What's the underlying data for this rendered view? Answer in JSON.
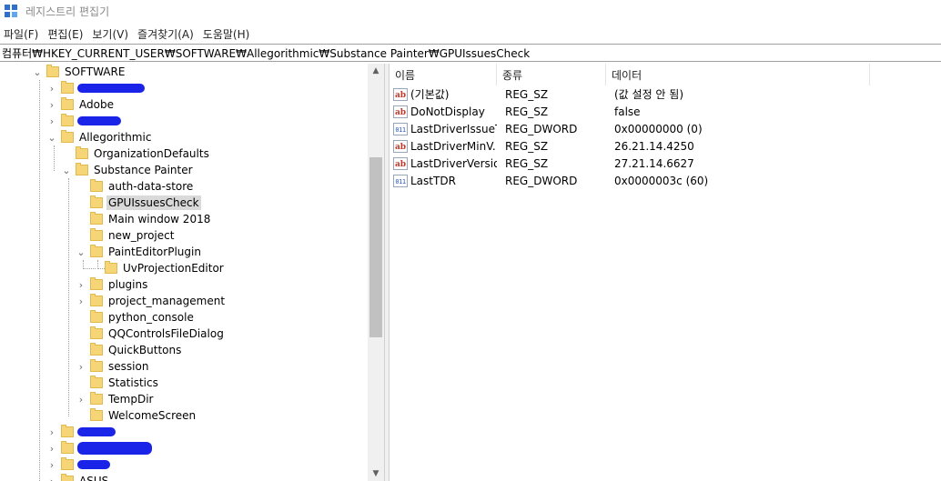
{
  "window": {
    "title": "레지스트리 편집기"
  },
  "menu": [
    "파일(F)",
    "편집(E)",
    "보기(V)",
    "즐겨찾기(A)",
    "도움말(H)"
  ],
  "address": "컴퓨터₩HKEY_CURRENT_USER₩SOFTWARE₩Allegorithmic₩Substance Painter₩GPUIssuesCheck",
  "tree": {
    "software": "SOFTWARE",
    "adobe": "Adobe",
    "allegorithmic": "Allegorithmic",
    "organization_defaults": "OrganizationDefaults",
    "substance_painter": "Substance Painter",
    "children": [
      "auth-data-store",
      "GPUIssuesCheck",
      "Main window 2018",
      "new_project",
      "PaintEditorPlugin"
    ],
    "uv_projection_editor": "UvProjectionEditor",
    "more": [
      "plugins",
      "project_management",
      "python_console",
      "QQControlsFileDialog",
      "QuickButtons",
      "session",
      "Statistics",
      "TempDir",
      "WelcomeScreen"
    ],
    "asus": "ASUS"
  },
  "list": {
    "columns": [
      "이름",
      "종류",
      "데이터"
    ],
    "rows": [
      {
        "icon": "string-value-icon",
        "name": "(기본값)",
        "type": "REG_SZ",
        "data": "(값 설정 안 됨)"
      },
      {
        "icon": "string-value-icon",
        "name": "DoNotDisplay",
        "type": "REG_SZ",
        "data": "false"
      },
      {
        "icon": "dword-value-icon",
        "name": "LastDriverIssueT...",
        "type": "REG_DWORD",
        "data": "0x00000000 (0)"
      },
      {
        "icon": "string-value-icon",
        "name": "LastDriverMinV...",
        "type": "REG_SZ",
        "data": "26.21.14.4250"
      },
      {
        "icon": "string-value-icon",
        "name": "LastDriverVersion",
        "type": "REG_SZ",
        "data": "27.21.14.6627"
      },
      {
        "icon": "dword-value-icon",
        "name": "LastTDR",
        "type": "REG_DWORD",
        "data": "0x0000003c (60)"
      }
    ]
  },
  "colors": {
    "accent_blue": "#1a23e8",
    "folder": "#f5d576",
    "selection": "#d9d9d9"
  }
}
